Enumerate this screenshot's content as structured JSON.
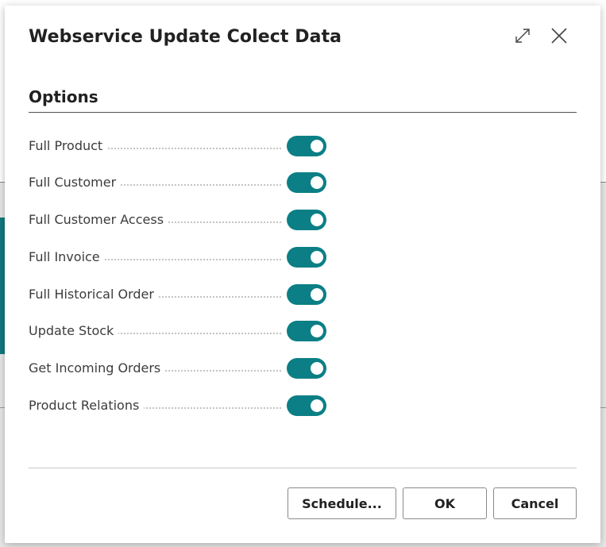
{
  "dialog": {
    "title": "Webservice Update Colect Data",
    "expand_icon": "expand-icon",
    "close_icon": "close-icon"
  },
  "section": {
    "title": "Options"
  },
  "options": [
    {
      "label": "Full Product",
      "enabled": true
    },
    {
      "label": "Full Customer",
      "enabled": true
    },
    {
      "label": "Full Customer Access",
      "enabled": true
    },
    {
      "label": "Full Invoice",
      "enabled": true
    },
    {
      "label": "Full Historical Order",
      "enabled": true
    },
    {
      "label": "Update Stock",
      "enabled": true
    },
    {
      "label": "Get Incoming Orders",
      "enabled": true
    },
    {
      "label": "Product Relations",
      "enabled": true
    }
  ],
  "buttons": {
    "schedule": "Schedule...",
    "ok": "OK",
    "cancel": "Cancel"
  },
  "colors": {
    "toggle_on": "#0b7f85",
    "accent": "#11797f"
  }
}
